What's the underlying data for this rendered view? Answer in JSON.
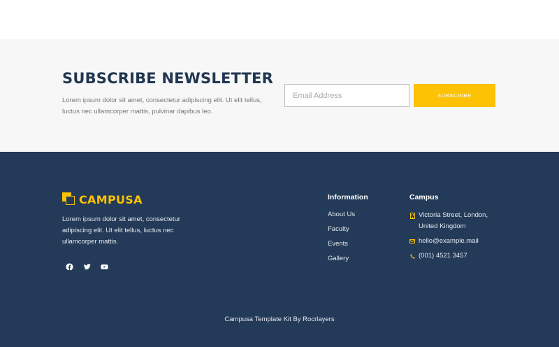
{
  "newsletter": {
    "title": "SUBSCRIBE NEWSLETTER",
    "description": "Lorem ipsum dolor sit amet, consectetur adipiscing elit. Ut elit tellus, luctus nec ullamcorper mattis, pulvinar dapibus leo.",
    "email_placeholder": "Email Address",
    "subscribe_label": "SUBSCRIBE"
  },
  "footer": {
    "brand": "CAMPUSA",
    "about": "Lorem ipsum dolor sit amet, consectetur adipiscing elit. Ut elit tellus, luctus nec ullamcorper mattis.",
    "socials": [
      "facebook-icon",
      "twitter-icon",
      "youtube-icon"
    ],
    "information": {
      "title": "Information",
      "links": [
        "About Us",
        "Faculty",
        "Events",
        "Gallery"
      ]
    },
    "campus": {
      "title": "Campus",
      "address": "Victoria Street, London, United Kingdom",
      "email": "hello@example.mail",
      "phone": "(001) 4521 3457"
    },
    "copyright": "Campusa Template Kit By Rocrlayers"
  },
  "colors": {
    "accent": "#fcc203",
    "footer_bg": "#233a58",
    "title": "#213751"
  }
}
